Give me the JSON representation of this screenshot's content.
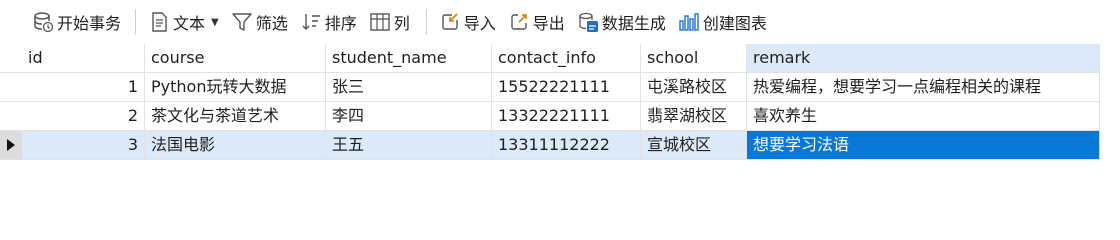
{
  "toolbar": {
    "begin_transaction": "开始事务",
    "text": "文本",
    "filter": "筛选",
    "sort": "排序",
    "columns": "列",
    "import": "导入",
    "export": "导出",
    "data_generation": "数据生成",
    "create_chart": "创建图表"
  },
  "table": {
    "headers": {
      "id": "id",
      "course": "course",
      "student_name": "student_name",
      "contact_info": "contact_info",
      "school": "school",
      "remark": "remark"
    },
    "rows": [
      {
        "id": "1",
        "course": "Python玩转大数据",
        "student_name": "张三",
        "contact_info": "15522221111",
        "school": "屯溪路校区",
        "remark": "热爱编程，想要学习一点编程相关的课程"
      },
      {
        "id": "2",
        "course": "茶文化与茶道艺术",
        "student_name": "李四",
        "contact_info": "13322221111",
        "school": "翡翠湖校区",
        "remark": "喜欢养生"
      },
      {
        "id": "3",
        "course": "法国电影",
        "student_name": "王五",
        "contact_info": "13311112222",
        "school": "宣城校区",
        "remark": "想要学习法语"
      }
    ]
  },
  "colors": {
    "selected_row": "#dce9f8",
    "selected_cell": "#0a78d7",
    "selected_header": "#dbe9f8"
  }
}
